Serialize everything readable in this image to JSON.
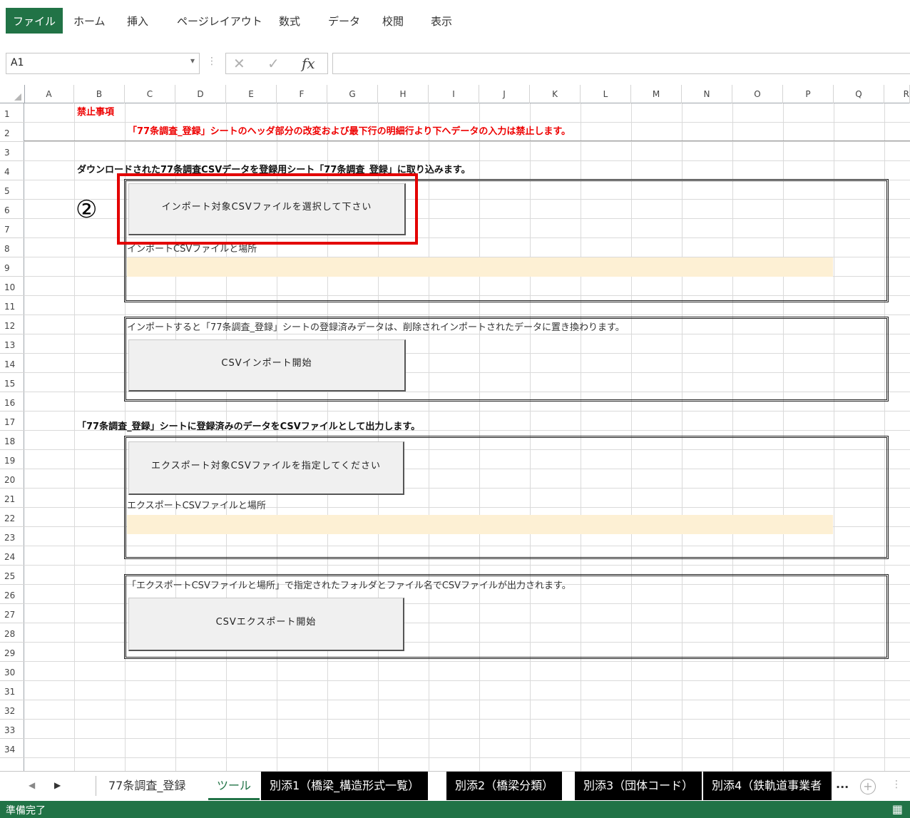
{
  "ribbon": {
    "tabs": [
      "ファイル",
      "ホーム",
      "挿入",
      "ページレイアウト",
      "数式",
      "データ",
      "校閲",
      "表示"
    ]
  },
  "formula_bar": {
    "name_box": "A1",
    "formula": ""
  },
  "columns": [
    "A",
    "B",
    "C",
    "D",
    "E",
    "F",
    "G",
    "H",
    "I",
    "J",
    "K",
    "L",
    "M",
    "N",
    "O",
    "P",
    "Q",
    "R"
  ],
  "rows": [
    "1",
    "2",
    "3",
    "4",
    "5",
    "6",
    "7",
    "8",
    "9",
    "10",
    "11",
    "12",
    "13",
    "14",
    "15",
    "16",
    "17",
    "18",
    "19",
    "20",
    "21",
    "22",
    "23",
    "24",
    "25",
    "26",
    "27",
    "28",
    "29",
    "30",
    "31",
    "32",
    "33",
    "34"
  ],
  "sheet": {
    "b1": "禁止事項",
    "c2": "「77条調査_登録」シートのヘッダ部分の改変および最下行の明細行より下へデータの入力は禁止します。",
    "b4": "ダウンロードされた77条調査CSVデータを登録用シート「77条調査_登録」に取り込みます。",
    "annotation_number": "②",
    "import_select_button": "インポート対象CSVファイルを選択して下さい",
    "import_path_label": "インポートCSVファイルと場所",
    "import_path_value": "",
    "import_note": "インポートすると「77条調査_登録」シートの登録済みデータは、削除されインポートされたデータに置き換わります。",
    "import_start_button": "CSVインポート開始",
    "b17": "「77条調査_登録」シートに登録済みのデータをCSVファイルとして出力します。",
    "export_select_button": "エクスポート対象CSVファイルを指定してください",
    "export_path_label": "エクスポートCSVファイルと場所",
    "export_path_value": "",
    "export_note": "「エクスポートCSVファイルと場所」で指定されたフォルダとファイル名でCSVファイルが出力されます。",
    "export_start_button": "CSVエクスポート開始"
  },
  "sheet_tabs": {
    "items": [
      "77条調査_登録",
      "ツール",
      "別添1（橋梁_構造形式一覧）",
      "別添2（橋梁分類）",
      "別添3（団体コード）",
      "別添4（鉄軌道事業者"
    ],
    "active": "ツール",
    "more": "..."
  },
  "status_bar": {
    "status": "準備完了"
  },
  "colors": {
    "excel_green": "#217346",
    "warning_red": "#ee0000",
    "path_fill": "#fdf0d4",
    "highlight_box": "#e30000"
  }
}
